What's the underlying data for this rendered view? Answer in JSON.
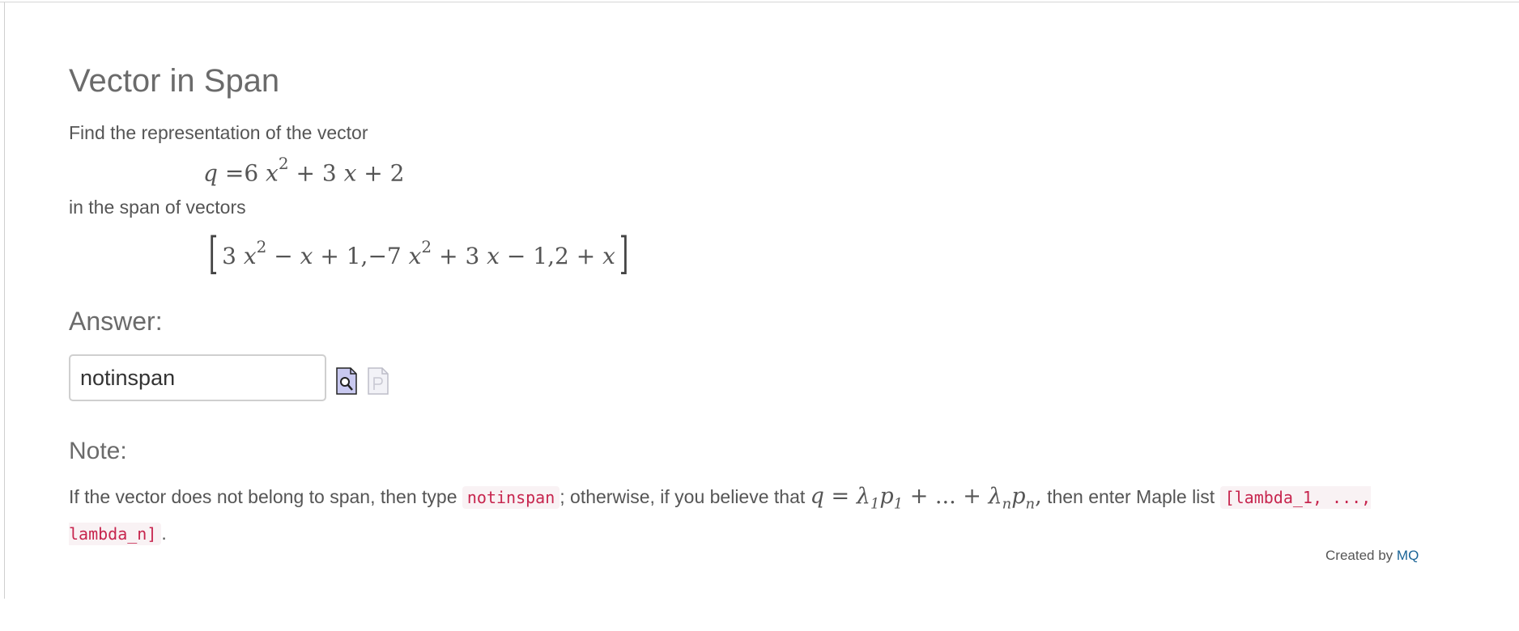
{
  "question": {
    "title": "Vector in Span",
    "intro": "Find the representation of the vector",
    "span_text": "in the span of vectors",
    "vector": {
      "lhs": "q",
      "equals": "=",
      "rhs_terms": [
        "6",
        "x",
        "2",
        "+",
        "3",
        "x",
        "+",
        "2"
      ]
    },
    "span_list": {
      "open": "[",
      "close": "]",
      "items": [
        [
          "3",
          "x",
          "2",
          "−",
          "x",
          "+",
          "1"
        ],
        [
          "−7",
          "x",
          "2",
          "+",
          "3",
          "x",
          "−",
          "1"
        ],
        [
          "2",
          "+",
          "x"
        ]
      ],
      "separator": ","
    }
  },
  "answer": {
    "heading": "Answer:",
    "value": "notinspan"
  },
  "note": {
    "heading": "Note:",
    "part1": "If the vector does not belong to span, then type",
    "code1": "notinspan",
    "part2": "; otherwise, if you believe that",
    "formula": {
      "q": "q",
      "eq": "=",
      "lambda": "λ",
      "p": "p",
      "sub1": "1",
      "subn": "n",
      "plus": "+",
      "dots": "...",
      "comma": ","
    },
    "part3": "then enter Maple list",
    "code2": "[lambda_1, ..., lambda_n]",
    "end": "."
  },
  "footer": {
    "created_by": "Created by",
    "link": "MQ"
  },
  "icons": {
    "validate": "validate-answer-icon",
    "preview": "preview-icon"
  }
}
